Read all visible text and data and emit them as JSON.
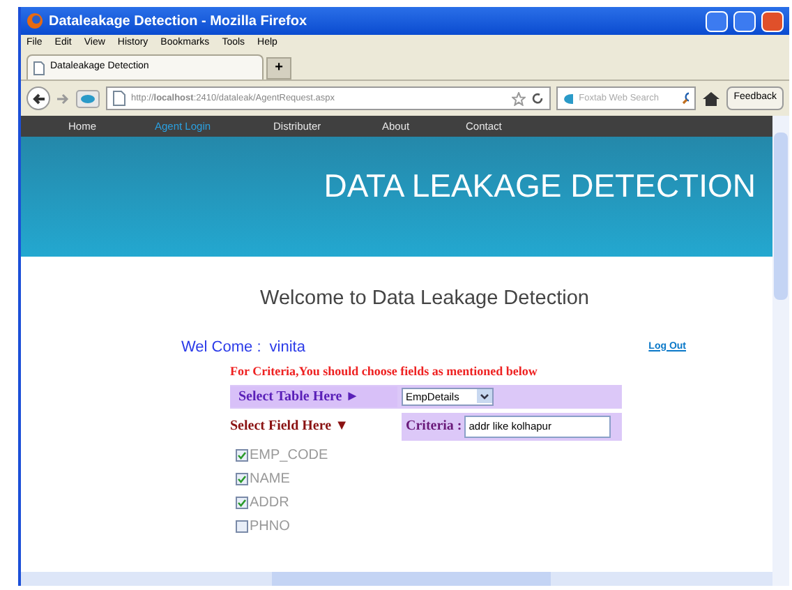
{
  "window": {
    "title": "Dataleakage Detection - Mozilla Firefox"
  },
  "menu": [
    "File",
    "Edit",
    "View",
    "History",
    "Bookmarks",
    "Tools",
    "Help"
  ],
  "tabs": [
    {
      "label": "Dataleakage Detection",
      "selected": true
    }
  ],
  "new_tab": "+",
  "address": "http://**localhost**:2410/dataleak/AgentRequest.aspx",
  "search": {
    "placeholder": "Foxtab Web Search"
  },
  "feedback": "Feedback",
  "site_nav": [
    {
      "label": "Home",
      "selected": false
    },
    {
      "label": "Agent Login",
      "selected": true
    },
    {
      "label": "Distributer",
      "selected": false
    },
    {
      "label": "About",
      "selected": false
    },
    {
      "label": "Contact",
      "selected": false
    }
  ],
  "banner": "DATA LEAKAGE DETECTION",
  "heading": "Welcome to Data Leakage Detection",
  "welcome": {
    "label": "Wel Come :",
    "user": "vinita"
  },
  "logout": "Log Out",
  "instruction": "For Criteria,You should choose fields as mentioned below",
  "table_label": "Select Table Here ►",
  "table_select": "EmpDetails",
  "field_label": "Select Field Here ▼",
  "criteria_label": "Criteria :",
  "criteria_value": "addr like kolhapur",
  "fields": [
    {
      "label": "EMP_CODE",
      "checked": true
    },
    {
      "label": "NAME",
      "checked": true
    },
    {
      "label": "ADDR",
      "checked": true
    },
    {
      "label": "PHNO",
      "checked": false
    }
  ]
}
